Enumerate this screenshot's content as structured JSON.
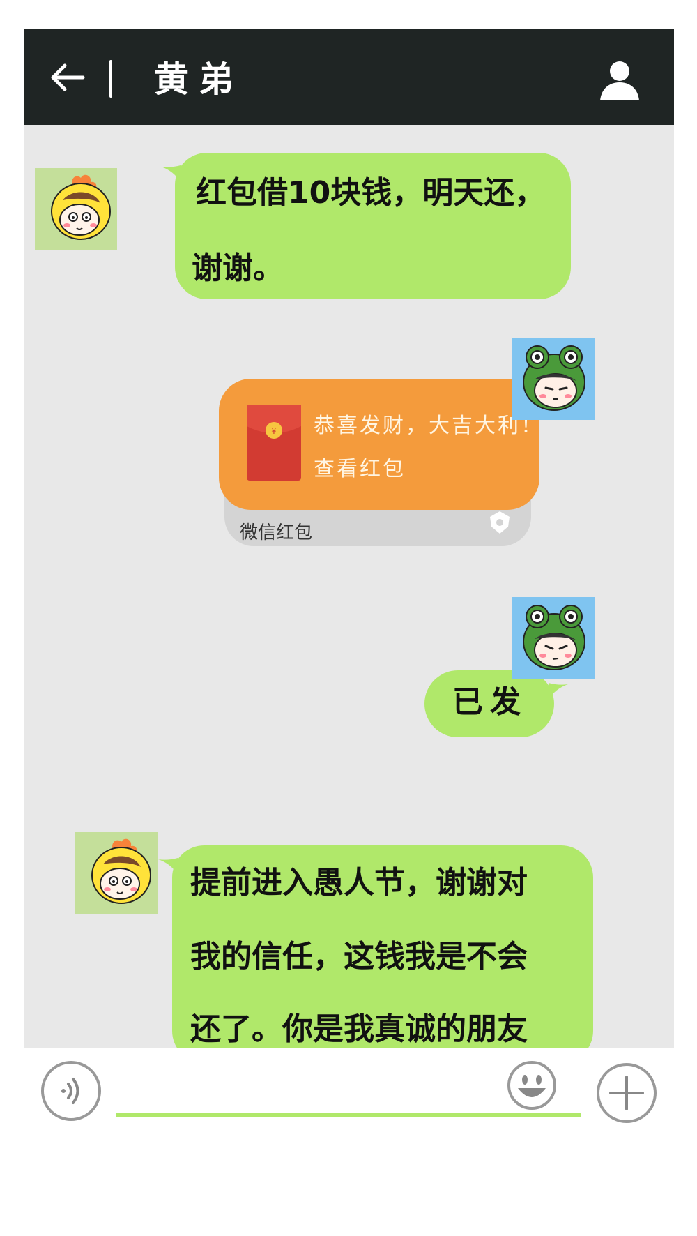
{
  "header": {
    "title": "黄弟"
  },
  "messages": [
    {
      "side": "left",
      "lines": [
        "红包借10块钱，明天还，",
        "谢谢。"
      ]
    },
    {
      "side": "right",
      "type": "red_packet",
      "greeting": "恭喜发财，大吉大利！",
      "action": "查看红包",
      "footer": "微信红包"
    },
    {
      "side": "right",
      "lines": [
        "已发"
      ]
    },
    {
      "side": "left",
      "lines": [
        "提前进入愚人节，谢谢对",
        "我的信任，这钱我是不会",
        "还了。你是我真诚的朋友"
      ]
    }
  ],
  "input": {
    "value": "",
    "placeholder": ""
  },
  "icons": {
    "back": "back-arrow-icon",
    "profile": "person-icon",
    "voice": "voice-icon",
    "emoji": "emoji-icon",
    "plus": "plus-icon"
  },
  "colors": {
    "header_bg": "#1f2524",
    "chat_bg": "#e8e8e8",
    "bubble_green": "#b0e86a",
    "red_packet_orange": "#f49b3c",
    "envelope_red": "#d23b32",
    "coin_gold": "#f7c640"
  }
}
